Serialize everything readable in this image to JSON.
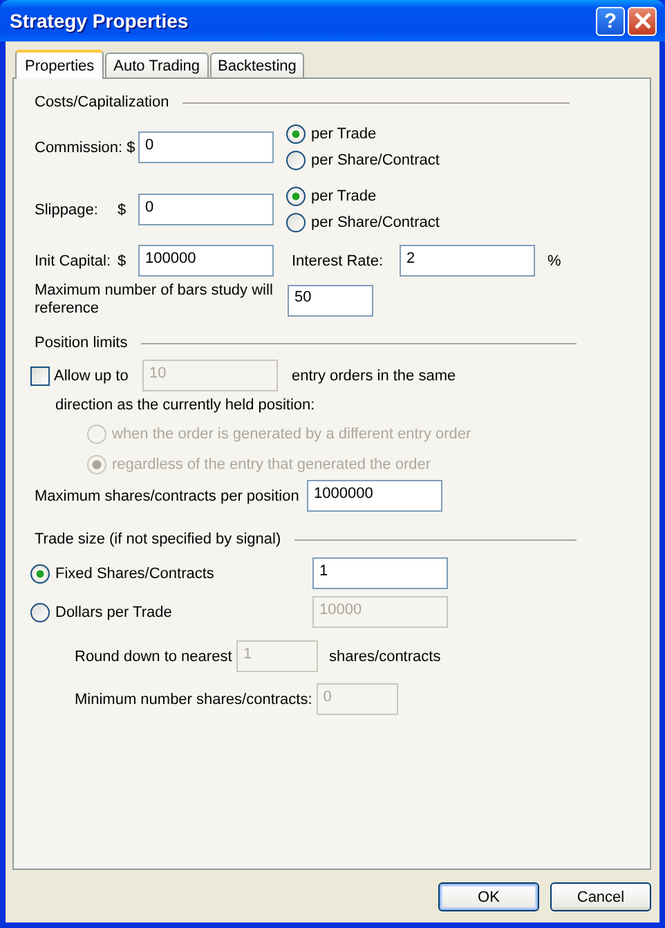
{
  "window": {
    "title": "Strategy Properties",
    "help": "?"
  },
  "tabs": [
    {
      "label": "Properties",
      "selected": true
    },
    {
      "label": "Auto Trading",
      "selected": false
    },
    {
      "label": "Backtesting",
      "selected": false
    }
  ],
  "costs": {
    "heading": "Costs/Capitalization",
    "commission": {
      "label": "Commission: $",
      "value": "0",
      "options": [
        {
          "label": "per Trade",
          "selected": true
        },
        {
          "label": "per Share/Contract",
          "selected": false
        }
      ]
    },
    "slippage": {
      "label": "Slippage:",
      "currency": "$",
      "value": "0",
      "options": [
        {
          "label": "per Trade",
          "selected": true
        },
        {
          "label": "per Share/Contract",
          "selected": false
        }
      ]
    },
    "init_capital": {
      "label": "Init Capital:",
      "currency": "$",
      "value": "100000"
    },
    "interest_rate": {
      "label": "Interest Rate:",
      "value": "2",
      "unit": "%"
    },
    "max_bars": {
      "label": "Maximum number of bars study will reference",
      "value": "50"
    }
  },
  "position_limits": {
    "heading": "Position limits",
    "allow": {
      "label": "Allow up to",
      "checked": false,
      "value": "10",
      "disabled": true,
      "suffix": "entry orders in the same"
    },
    "direction_label": "direction as the currently held position:",
    "options": [
      {
        "label": "when the order is generated by a different entry order",
        "selected": false,
        "disabled": true
      },
      {
        "label": "regardless of the entry that generated the order",
        "selected": true,
        "disabled": true
      }
    ],
    "max_shares": {
      "label": "Maximum shares/contracts per position",
      "value": "1000000"
    }
  },
  "trade_size": {
    "heading": "Trade size (if not specified by signal)",
    "options": [
      {
        "label": "Fixed Shares/Contracts",
        "selected": true,
        "value": "1",
        "disabled": false
      },
      {
        "label": "Dollars per Trade",
        "selected": false,
        "value": "10000",
        "disabled": true
      }
    ],
    "round_down": {
      "label": "Round down to nearest",
      "value": "1",
      "disabled": true,
      "suffix": "shares/contracts"
    },
    "minimum": {
      "label": "Minimum number shares/contracts:",
      "value": "0",
      "disabled": true
    }
  },
  "buttons": [
    {
      "label": "OK",
      "default": true
    },
    {
      "label": "Cancel",
      "default": false
    }
  ]
}
